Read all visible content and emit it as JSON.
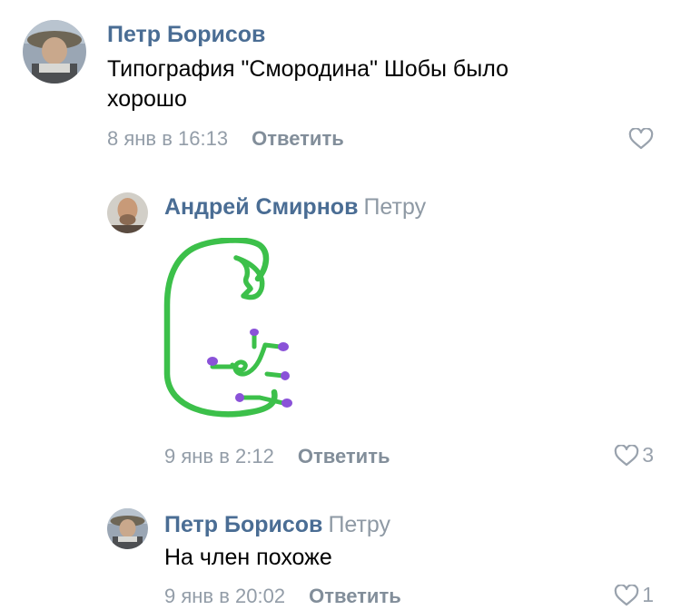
{
  "comments": [
    {
      "author": "Петр Борисов",
      "addressee": "",
      "text_lines": [
        "Типография \"Смородина\" Шобы было",
        "хорошо"
      ],
      "date": "8 янв в 16:13",
      "reply_label": "Ответить",
      "likes": ""
    },
    {
      "author": "Андрей Смирнов",
      "addressee": "Петру",
      "attachment": "drawing",
      "date": "9 янв в 2:12",
      "reply_label": "Ответить",
      "likes": "3"
    },
    {
      "author": "Петр Борисов",
      "addressee": "Петру",
      "text_lines": [
        "На член похоже"
      ],
      "date": "9 янв в 20:02",
      "reply_label": "Ответить",
      "likes": "1"
    }
  ],
  "colors": {
    "author": "#4a6d94",
    "meta": "#939da8",
    "reply": "#828e9a",
    "like": "#99a2ad",
    "drawing_stroke": "#3cc04a",
    "drawing_dots": "#8a52d8"
  },
  "icons": {
    "like": "heart-outline-icon"
  }
}
